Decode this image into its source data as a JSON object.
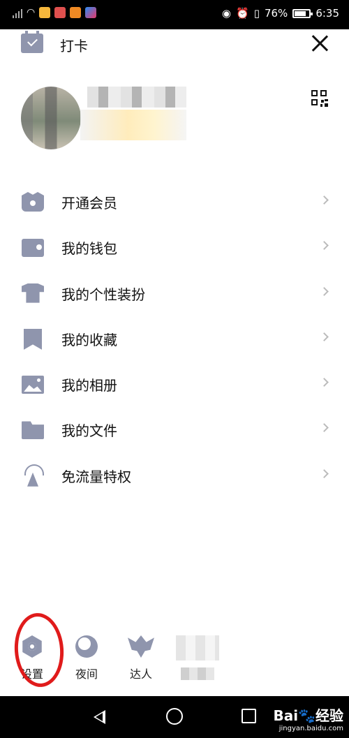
{
  "status_bar": {
    "battery": "76%",
    "time": "6:35"
  },
  "header": {
    "checkin_label": "打卡"
  },
  "menu": {
    "items": [
      {
        "label": "开通会员",
        "icon": "crown-icon"
      },
      {
        "label": "我的钱包",
        "icon": "wallet-icon"
      },
      {
        "label": "我的个性装扮",
        "icon": "shirt-icon"
      },
      {
        "label": "我的收藏",
        "icon": "bookmark-icon"
      },
      {
        "label": "我的相册",
        "icon": "photo-icon"
      },
      {
        "label": "我的文件",
        "icon": "folder-icon"
      },
      {
        "label": "免流量特权",
        "icon": "signal-tower-icon"
      }
    ]
  },
  "bottom_bar": {
    "settings_label": "设置",
    "night_label": "夜间",
    "expert_label": "达人"
  },
  "colors": {
    "icon_gray": "#8f95ad",
    "annotation_red": "#e01b1b"
  },
  "watermark": {
    "logo": "Bai🐾经验",
    "url": "jingyan.baidu.com"
  }
}
